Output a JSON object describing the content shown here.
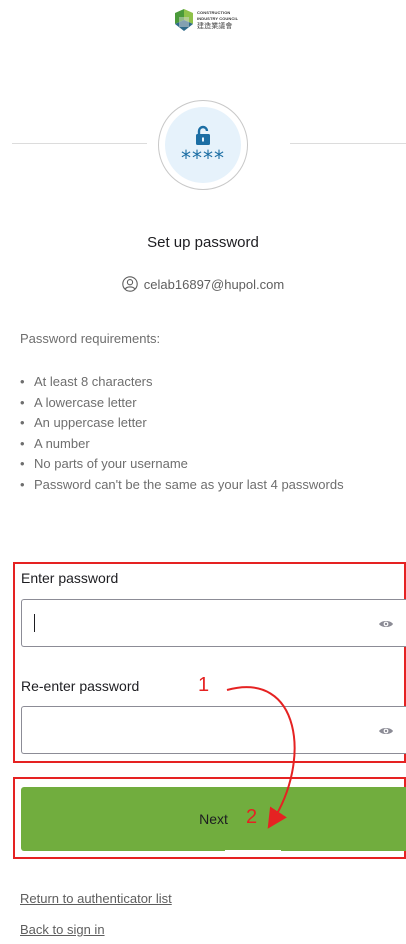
{
  "logo": {
    "line1": "CONSTRUCTION",
    "line2": "INDUSTRY COUNCIL",
    "line3": "建造業議會"
  },
  "authenticator": {
    "icon": "lock-icon",
    "mask": "****"
  },
  "title": "Set up password",
  "identity": {
    "icon": "user-icon",
    "email": "celab16897@hupol.com"
  },
  "requirements": {
    "heading": "Password requirements:",
    "items": [
      "At least 8 characters",
      "A lowercase letter",
      "An uppercase letter",
      "A number",
      "No parts of your username",
      "Password can't be the same as your last 4 passwords"
    ]
  },
  "fields": {
    "password_label": "Enter password",
    "password_value": "",
    "confirm_label": "Re-enter password",
    "confirm_value": ""
  },
  "next_label": "Next",
  "annotations": {
    "step1": "1",
    "step2": "2",
    "color": "#e52222"
  },
  "links": {
    "return": "Return to authenticator list",
    "back": "Back to sign in"
  },
  "colors": {
    "button": "#71ad3e",
    "accent": "#1c6ea4"
  }
}
